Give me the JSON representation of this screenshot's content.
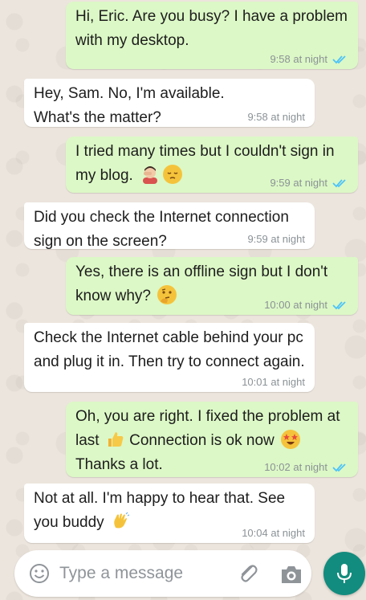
{
  "colors": {
    "outgoing_bubble": "#dcf8c6",
    "incoming_bubble": "#ffffff",
    "read_ticks": "#4fc3f7",
    "accent": "#128c7e"
  },
  "messages": [
    {
      "direction": "out",
      "text": "Hi, Eric. Are you busy?  I have a problem with my desktop.",
      "time": "9:58 at night",
      "status": "read"
    },
    {
      "direction": "in",
      "text": "Hey, Sam. No, I'm available. What's the matter?",
      "time": "9:58 at night"
    },
    {
      "direction": "out",
      "text": "I tried many times but I couldn't sign in my blog.",
      "emojis": [
        "facepalm-emoji",
        "pensive-emoji"
      ],
      "time": "9:59 at night",
      "status": "read"
    },
    {
      "direction": "in",
      "text": "Did you check the Internet connection sign on the screen?",
      "time": "9:59 at night"
    },
    {
      "direction": "out",
      "text": "Yes, there is an offline sign but I don't know why?",
      "emojis": [
        "thinking-emoji"
      ],
      "time": "10:00 at night",
      "status": "read"
    },
    {
      "direction": "in",
      "text": "Check the Internet cable behind your pc and plug it in. Then try to connect again.",
      "time": "10:01 at night"
    },
    {
      "direction": "out",
      "text_part1": "Oh, you are right. I fixed the problem at last",
      "text_part2": "Connection is ok now",
      "text_part3": "Thanks a lot.",
      "emojis": [
        "thumbs-up-emoji",
        "star-struck-emoji"
      ],
      "time": "10:02 at night",
      "status": "read"
    },
    {
      "direction": "in",
      "text": "Not at all. I'm happy to hear that. See you buddy",
      "emojis": [
        "waving-hand-emoji"
      ],
      "time": "10:04 at night"
    }
  ],
  "composer": {
    "placeholder": "Type a message",
    "icons": [
      "emoji-smiley-icon",
      "paperclip-icon",
      "camera-icon",
      "microphone-icon"
    ]
  }
}
